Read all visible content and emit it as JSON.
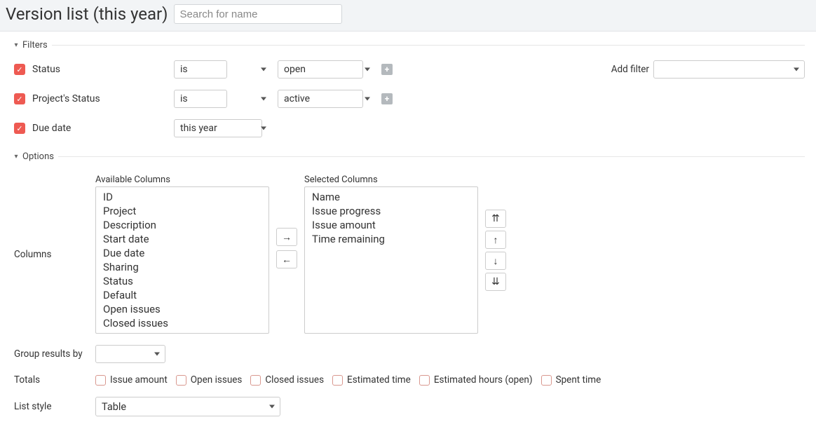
{
  "header": {
    "title": "Version list (this year)",
    "search_placeholder": "Search for name"
  },
  "sections": {
    "filters_label": "Filters",
    "options_label": "Options"
  },
  "add_filter": {
    "label": "Add filter",
    "value": ""
  },
  "filters": [
    {
      "field": "Status",
      "operator": "is",
      "value": "open",
      "has_plus": true
    },
    {
      "field": "Project's Status",
      "operator": "is",
      "value": "active",
      "has_plus": true
    },
    {
      "field": "Due date",
      "operator": "this year",
      "value": null,
      "has_plus": false
    }
  ],
  "columns": {
    "row_label": "Columns",
    "available_caption": "Available Columns",
    "selected_caption": "Selected Columns",
    "available": [
      "ID",
      "Project",
      "Description",
      "Start date",
      "Due date",
      "Sharing",
      "Status",
      "Default",
      "Open issues",
      "Closed issues"
    ],
    "selected": [
      "Name",
      "Issue progress",
      "Issue amount",
      "Time remaining"
    ],
    "move_right_glyph": "→",
    "move_left_glyph": "←",
    "move_top_glyph": "⇈",
    "move_up_glyph": "↑",
    "move_down_glyph": "↓",
    "move_bottom_glyph": "⇊"
  },
  "group_by": {
    "label": "Group results by",
    "value": ""
  },
  "totals": {
    "label": "Totals",
    "options": [
      "Issue amount",
      "Open issues",
      "Closed issues",
      "Estimated time",
      "Estimated hours (open)",
      "Spent time"
    ]
  },
  "list_style": {
    "label": "List style",
    "value": "Table"
  }
}
